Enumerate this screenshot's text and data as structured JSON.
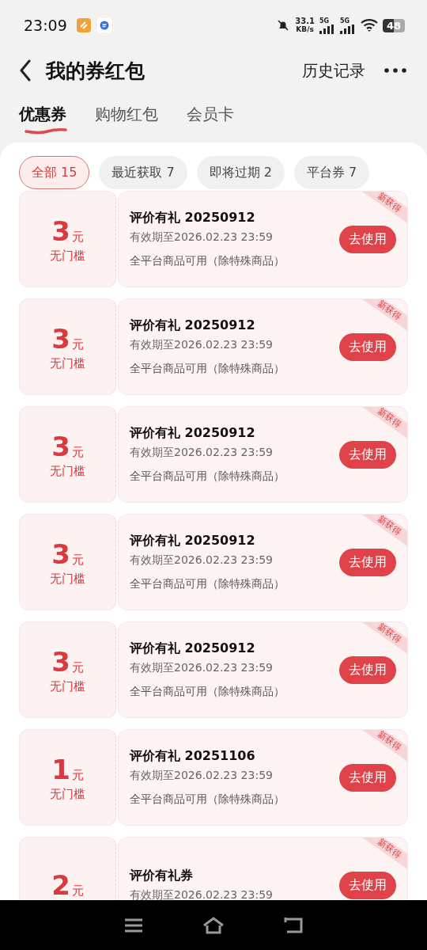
{
  "status_bar": {
    "time": "23:09",
    "speed_value": "33.1",
    "speed_unit": "KB/s",
    "network_1": "5G",
    "network_2": "5G",
    "battery": "48"
  },
  "header": {
    "title": "我的券红包",
    "action": "历史记录"
  },
  "tabs": [
    {
      "label": "优惠券",
      "selected": true
    },
    {
      "label": "购物红包",
      "selected": false
    },
    {
      "label": "会员卡",
      "selected": false
    }
  ],
  "filters": [
    {
      "label": "全部 15",
      "selected": true
    },
    {
      "label": "最近获取 7",
      "selected": false
    },
    {
      "label": "即将过期 2",
      "selected": false
    },
    {
      "label": "平台券 7",
      "selected": false
    }
  ],
  "coupons": [
    {
      "amount": "3",
      "unit": "元",
      "threshold": "无门槛",
      "title": "评价有礼 20250912",
      "validity": "有效期至2026.02.23 23:59",
      "scope": "全平台商品可用（除特殊商品）",
      "button": "去使用",
      "badge": "新获得"
    },
    {
      "amount": "3",
      "unit": "元",
      "threshold": "无门槛",
      "title": "评价有礼 20250912",
      "validity": "有效期至2026.02.23 23:59",
      "scope": "全平台商品可用（除特殊商品）",
      "button": "去使用",
      "badge": "新获得"
    },
    {
      "amount": "3",
      "unit": "元",
      "threshold": "无门槛",
      "title": "评价有礼 20250912",
      "validity": "有效期至2026.02.23 23:59",
      "scope": "全平台商品可用（除特殊商品）",
      "button": "去使用",
      "badge": "新获得"
    },
    {
      "amount": "3",
      "unit": "元",
      "threshold": "无门槛",
      "title": "评价有礼 20250912",
      "validity": "有效期至2026.02.23 23:59",
      "scope": "全平台商品可用（除特殊商品）",
      "button": "去使用",
      "badge": "新获得"
    },
    {
      "amount": "3",
      "unit": "元",
      "threshold": "无门槛",
      "title": "评价有礼 20250912",
      "validity": "有效期至2026.02.23 23:59",
      "scope": "全平台商品可用（除特殊商品）",
      "button": "去使用",
      "badge": "新获得"
    },
    {
      "amount": "1",
      "unit": "元",
      "threshold": "无门槛",
      "title": "评价有礼 20251106",
      "validity": "有效期至2026.02.23 23:59",
      "scope": "全平台商品可用（除特殊商品）",
      "button": "去使用",
      "badge": "新获得"
    },
    {
      "amount": "2",
      "unit": "元",
      "title": "评价有礼券",
      "validity": "有效期至2026.02.23 23:59",
      "button": "去使用",
      "badge": "新获得"
    }
  ]
}
